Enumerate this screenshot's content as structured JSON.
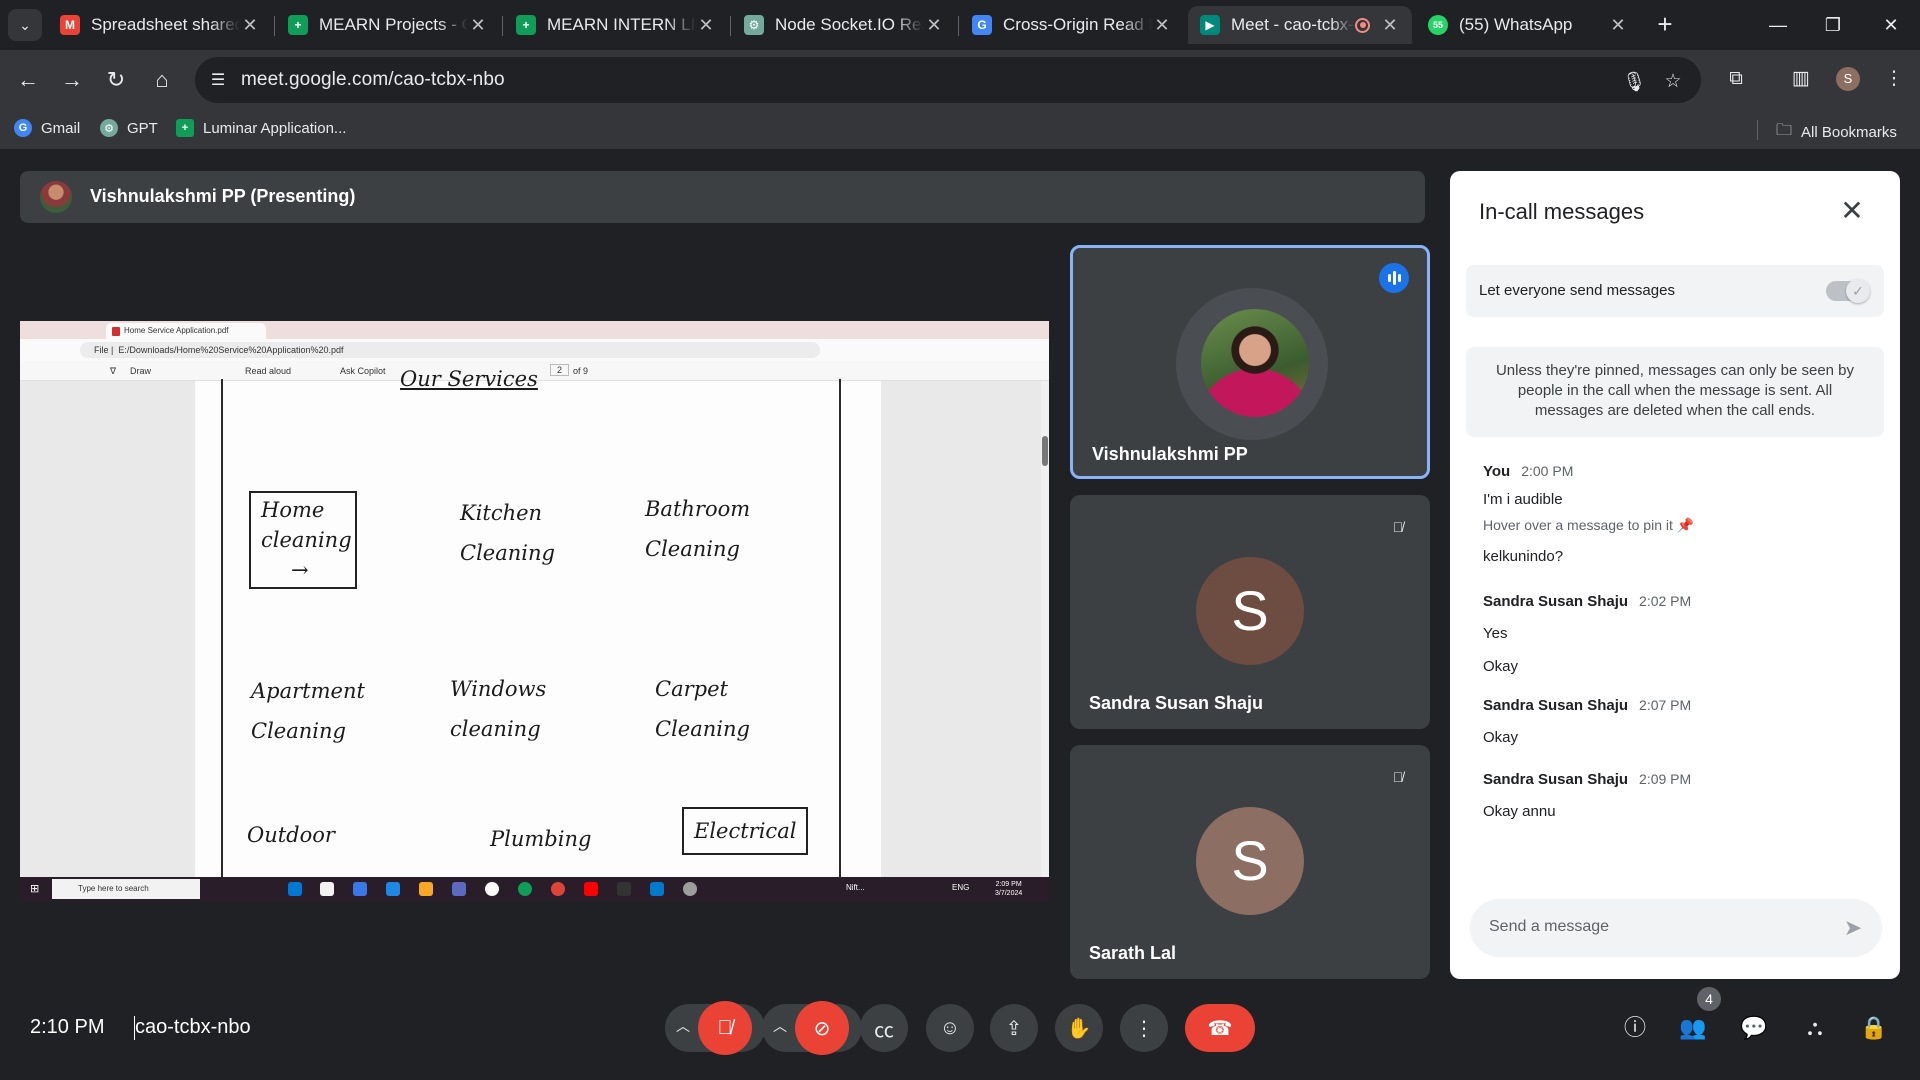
{
  "browser": {
    "tabs": [
      {
        "title": "Spreadsheet shared with you",
        "icon": "gmail-icon",
        "color": "#ea4335",
        "glyph": "M"
      },
      {
        "title": "MEARN Projects - Google Sheets",
        "icon": "sheets-icon",
        "color": "#0f9d58",
        "glyph": "+"
      },
      {
        "title": "MEARN INTERN LIST - Google Sheets",
        "icon": "sheets-icon",
        "color": "#0f9d58",
        "glyph": "+"
      },
      {
        "title": "Node Socket.IO React",
        "icon": "chatgpt-icon",
        "color": "#74aa9c",
        "glyph": "⚙"
      },
      {
        "title": "Cross-Origin Read Blocking",
        "icon": "google-icon",
        "color": "#4285f4",
        "glyph": "G"
      },
      {
        "title": "Meet - cao-tcbx-nbo",
        "icon": "meet-icon",
        "color": "#00897b",
        "glyph": "▶"
      },
      {
        "title": "(55) WhatsApp",
        "icon": "whatsapp-icon",
        "color": "#25d366",
        "glyph": "55"
      }
    ],
    "url": "meet.google.com/cao-tcbx-nbo",
    "bookmarks": [
      {
        "label": "Gmail",
        "icon": "google-icon",
        "color": "#4285f4"
      },
      {
        "label": "GPT",
        "icon": "chatgpt-icon",
        "color": "#74aa9c"
      },
      {
        "label": "Luminar Application...",
        "icon": "sheets-icon",
        "color": "#0f9d58"
      }
    ],
    "all_bookmarks": "All Bookmarks"
  },
  "meet": {
    "presenting_label": "Vishnulakshmi PP (Presenting)",
    "shared_screen": {
      "tab_title": "Home Service Application.pdf",
      "file_label": "File",
      "path": "E:/Downloads/Home%20Service%20Application%20.pdf",
      "draw": "Draw",
      "read_aloud": "Read aloud",
      "ask_copilot": "Ask Copilot",
      "page": "2",
      "of_pages": "of 9",
      "handwriting": {
        "top": "Our Services",
        "home": "Home cleaning",
        "arrow": "→",
        "kitchen": "Kitchen Cleaning",
        "bathroom": "Bathroom Cleaning",
        "apartment": "Apartment Cleaning",
        "windows": "Windows cleaning",
        "carpet": "Carpet Cleaning",
        "outdoor": "Outdoor",
        "plumbing": "Plumbing",
        "electrical": "Electrical"
      },
      "taskbar_search": "Type here to search",
      "taskbar_time": "2:09 PM",
      "taskbar_date": "3/7/2024",
      "taskbar_lang": "ENG",
      "taskbar_stock": "Nift..."
    },
    "participants": [
      {
        "name": "Vishnulakshmi PP",
        "speaking": true
      },
      {
        "name": "Sandra Susan Shaju",
        "initial": "S",
        "color": "#6d4c41",
        "muted": true
      },
      {
        "name": "Sarath Lal",
        "initial": "S",
        "color": "#8d6e63",
        "muted": true
      }
    ],
    "time": "2:10 PM",
    "code": "cao-tcbx-nbo",
    "people_count": "4"
  },
  "chat": {
    "title": "In-call messages",
    "toggle_label": "Let everyone send messages",
    "note": "Unless they're pinned, messages can only be seen by people in the call when the message is sent. All messages are deleted when the call ends.",
    "messages": [
      {
        "sender": "You",
        "time": "2:00 PM",
        "lines": [
          "I'm i audible"
        ],
        "hint": "Hover over a message to pin it",
        "after": "kelkunindo?"
      },
      {
        "sender": "Sandra Susan Shaju",
        "time": "2:02 PM",
        "lines": [
          "Yes",
          "Okay"
        ]
      },
      {
        "sender": "Sandra Susan Shaju",
        "time": "2:07 PM",
        "lines": [
          "Okay"
        ]
      },
      {
        "sender": "Sandra Susan Shaju",
        "time": "2:09 PM",
        "lines": [
          "Okay annu"
        ]
      }
    ],
    "input_placeholder": "Send a message"
  }
}
